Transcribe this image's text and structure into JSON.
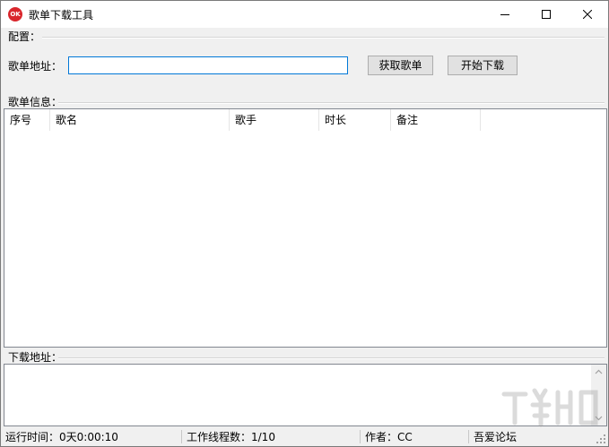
{
  "window": {
    "title": "歌单下载工具",
    "icon_text": "OK"
  },
  "config": {
    "group_label": "配置：",
    "url_label": "歌单地址：",
    "url_value": "",
    "fetch_button": "获取歌单",
    "start_button": "开始下载"
  },
  "playlist": {
    "group_label": "歌单信息：",
    "columns": [
      "序号",
      "歌名",
      "歌手",
      "时长",
      "备注"
    ]
  },
  "download": {
    "group_label": "下载地址：",
    "value": ""
  },
  "status": {
    "run_time": "运行时间：0天0:00:10",
    "threads": "工作线程数：1/10",
    "author": "作者：CC",
    "forum": "吾爱论坛"
  },
  "colors": {
    "input_border": "#0078d7",
    "app_icon": "#d9262c"
  }
}
